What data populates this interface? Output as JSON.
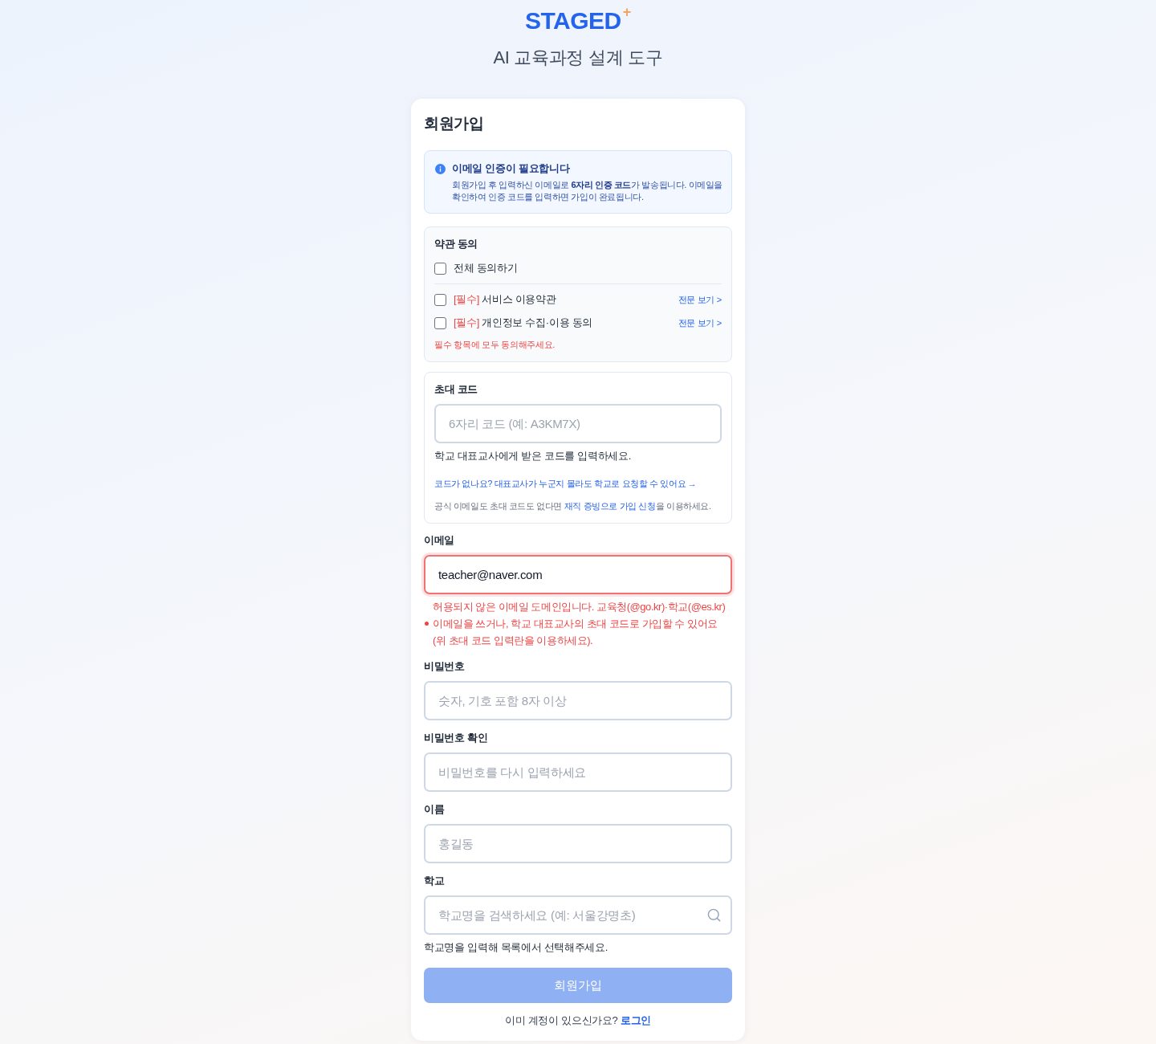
{
  "logo": {
    "name": "STAGED",
    "mark": "+"
  },
  "tagline": "AI 교육과정 설계 도구",
  "signup": {
    "title": "회원가입",
    "notice": {
      "title": "이메일 인증이 필요합니다",
      "text": "회원가입 후 입력하신 이메일로 **6자리 인증 코드**가 발송됩니다. 이메일을 확인하여 인증 코드를 입력하면 가입이 완료됩니다."
    },
    "terms": {
      "title": "약관 동의",
      "all": {
        "label": "전체 동의하기",
        "checked": false
      },
      "items": [
        {
          "tag": "[필수]",
          "label": "서비스 이용약관",
          "checked": false,
          "link": "전문 보기 >"
        },
        {
          "tag": "[필수]",
          "label": "개인정보 수집·이용 동의",
          "checked": false,
          "link": "전문 보기 >"
        }
      ],
      "error": "필수 항목에 모두 동의해주세요."
    },
    "invite": {
      "label": "초대 코드",
      "placeholder": "6자리 코드 (예: A3KM7X)",
      "help": "학교 대표교사에게 받은 코드를 입력하세요.",
      "request_link": "코드가 없나요? 대표교사가 누군지 몰라도 학교로 요청할 수 있어요 →",
      "note": {
        "before": "공식 이메일도 초대 코드도 없다면 ",
        "link": "재직 증빙으로 가입 신청",
        "after": "을 이용하세요."
      }
    },
    "fields": [
      {
        "kind": "email",
        "label": "이메일",
        "value": "teacher@naver.com",
        "invalid": true,
        "error": "허용되지 않은 이메일 도메인입니다. 교육청(@go.kr)·학교(@es.kr) 이메일을 쓰거나, 학교 대표교사의 초대 코드로 가입할 수 있어요 (위 초대 코드 입력란을 이용하세요)."
      },
      {
        "kind": "password",
        "label": "비밀번호",
        "placeholder": "숫자, 기호 포함 8자 이상",
        "invalid": false
      },
      {
        "kind": "password",
        "label": "비밀번호 확인",
        "placeholder": "비밀번호를 다시 입력하세요",
        "invalid": false
      },
      {
        "kind": "text",
        "label": "이름",
        "placeholder": "홍길동",
        "invalid": false
      },
      {
        "kind": "search",
        "label": "학교",
        "placeholder": "학교명을 검색하세요 (예: 서울강명초)",
        "invalid": false,
        "help": "학교명을 입력해 목록에서 선택해주세요."
      }
    ],
    "submit": {
      "label": "회원가입",
      "disabled": true
    },
    "footer": {
      "text": "이미 계정이 있으신가요?",
      "link": "로그인"
    }
  }
}
